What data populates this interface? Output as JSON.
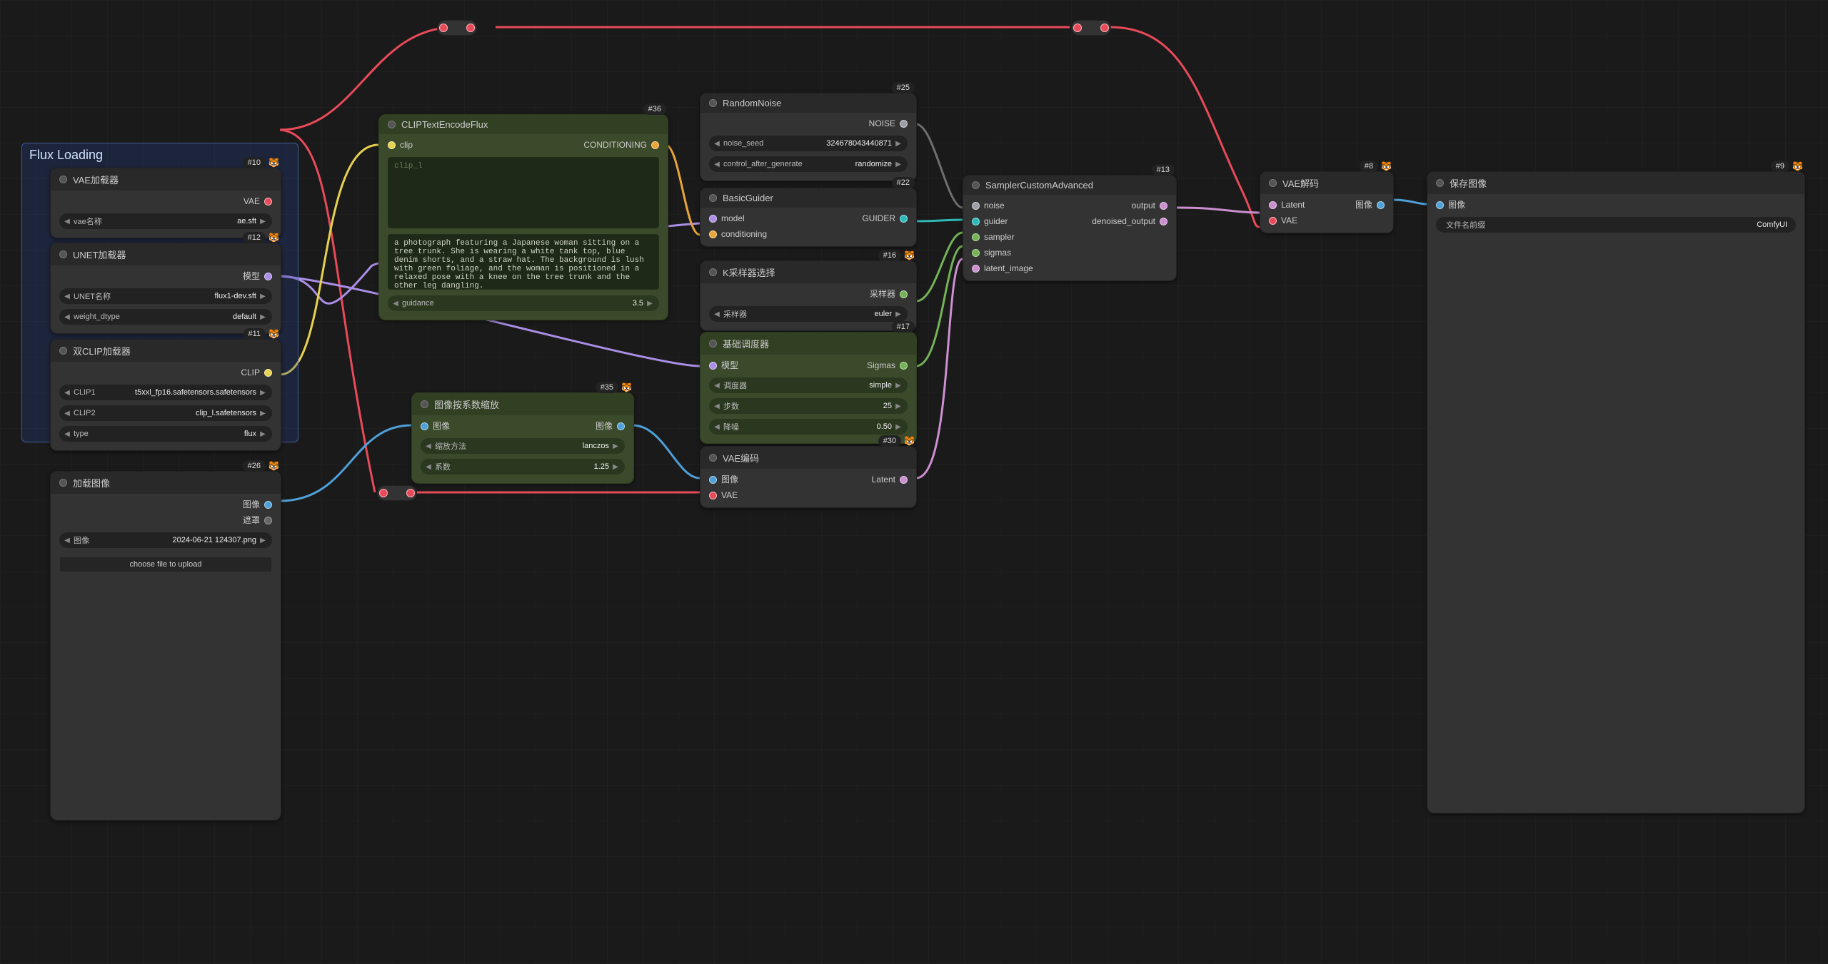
{
  "group": {
    "title": "Flux Loading"
  },
  "nodes": {
    "vae_loader": {
      "id": "#10",
      "title": "VAE加载器",
      "outputs": [
        {
          "label": "VAE"
        }
      ],
      "widgets": [
        {
          "name": "vae名称",
          "value": "ae.sft"
        }
      ]
    },
    "unet_loader": {
      "id": "#12",
      "title": "UNET加载器",
      "outputs": [
        {
          "label": "模型"
        }
      ],
      "widgets": [
        {
          "name": "UNET名称",
          "value": "flux1-dev.sft"
        },
        {
          "name": "weight_dtype",
          "value": "default"
        }
      ]
    },
    "dual_clip": {
      "id": "#11",
      "title": "双CLIP加载器",
      "outputs": [
        {
          "label": "CLIP"
        }
      ],
      "widgets": [
        {
          "name": "CLIP1",
          "value": "t5xxl_fp16.safetensors.safetensors"
        },
        {
          "name": "CLIP2",
          "value": "clip_l.safetensors"
        },
        {
          "name": "type",
          "value": "flux"
        }
      ]
    },
    "load_image": {
      "id": "#26",
      "title": "加载图像",
      "outputs": [
        {
          "label": "图像"
        },
        {
          "label": "遮罩"
        }
      ],
      "widgets": [
        {
          "name": "图像",
          "value": "2024-06-21 124307.png"
        }
      ],
      "upload": "choose file to upload"
    },
    "clip_text": {
      "id": "#36",
      "title": "CLIPTextEncodeFlux",
      "inputs": [
        {
          "label": "clip"
        }
      ],
      "outputs": [
        {
          "label": "CONDITIONING"
        }
      ],
      "placeholder": "clip_l",
      "prompt": "a photograph featuring a Japanese woman sitting on a tree trunk. She is wearing a white tank top, blue denim shorts, and a straw hat. The background is lush with green foliage, and the woman is positioned in a relaxed pose with a knee on the tree trunk and the other leg dangling.",
      "widgets": [
        {
          "name": "guidance",
          "value": "3.5"
        }
      ]
    },
    "upscale": {
      "id": "#35",
      "title": "图像按系数缩放",
      "inputs": [
        {
          "label": "图像"
        }
      ],
      "outputs": [
        {
          "label": "图像"
        }
      ],
      "widgets": [
        {
          "name": "缩放方法",
          "value": "lanczos"
        },
        {
          "name": "系数",
          "value": "1.25"
        }
      ]
    },
    "random_noise": {
      "id": "#25",
      "title": "RandomNoise",
      "outputs": [
        {
          "label": "NOISE"
        }
      ],
      "widgets": [
        {
          "name": "noise_seed",
          "value": "324678043440871"
        },
        {
          "name": "control_after_generate",
          "value": "randomize"
        }
      ]
    },
    "basic_guider": {
      "id": "#22",
      "title": "BasicGuider",
      "inputs": [
        {
          "label": "model"
        },
        {
          "label": "conditioning"
        }
      ],
      "outputs": [
        {
          "label": "GUIDER"
        }
      ]
    },
    "ksampler_select": {
      "id": "#16",
      "title": "K采样器选择",
      "outputs": [
        {
          "label": "采样器"
        }
      ],
      "widgets": [
        {
          "name": "采样器",
          "value": "euler"
        }
      ]
    },
    "basic_sched": {
      "id": "#17",
      "title": "基础调度器",
      "inputs": [
        {
          "label": "模型"
        }
      ],
      "outputs": [
        {
          "label": "Sigmas"
        }
      ],
      "widgets": [
        {
          "name": "调度器",
          "value": "simple"
        },
        {
          "name": "步数",
          "value": "25"
        },
        {
          "name": "降噪",
          "value": "0.50"
        }
      ]
    },
    "vae_encode": {
      "id": "#30",
      "title": "VAE编码",
      "inputs": [
        {
          "label": "图像"
        },
        {
          "label": "VAE"
        }
      ],
      "outputs": [
        {
          "label": "Latent"
        }
      ]
    },
    "sampler_adv": {
      "id": "#13",
      "title": "SamplerCustomAdvanced",
      "inputs": [
        {
          "label": "noise"
        },
        {
          "label": "guider"
        },
        {
          "label": "sampler"
        },
        {
          "label": "sigmas"
        },
        {
          "label": "latent_image"
        }
      ],
      "outputs": [
        {
          "label": "output"
        },
        {
          "label": "denoised_output"
        }
      ]
    },
    "vae_decode": {
      "id": "#8",
      "title": "VAE解码",
      "inputs": [
        {
          "label": "Latent"
        },
        {
          "label": "VAE"
        }
      ],
      "outputs": [
        {
          "label": "图像"
        }
      ]
    },
    "save_image": {
      "id": "#9",
      "title": "保存图像",
      "inputs": [
        {
          "label": "图像"
        }
      ],
      "widgets": [
        {
          "name": "文件名前缀",
          "value": "ComfyUI"
        }
      ]
    }
  },
  "face": "🐯"
}
